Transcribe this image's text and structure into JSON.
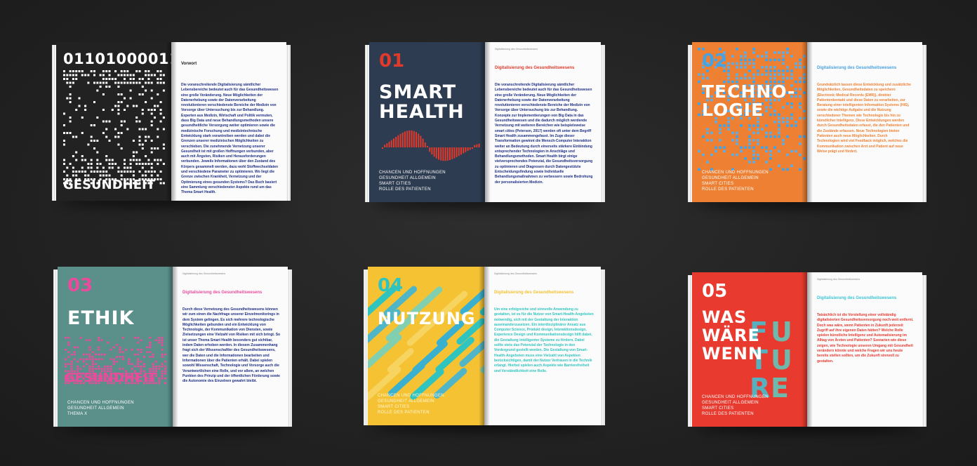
{
  "colors": {
    "background": "#262626",
    "book1_left": "#222222",
    "book1_accent": "#1f2f86",
    "book2_left": "#2d3c50",
    "book2_accent": "#e03a2c",
    "book3_left": "#ee8033",
    "book3_accent": "#4aa1e0",
    "book4_left": "#5b8f8a",
    "book4_accent": "#ea4b9c",
    "book5_left": "#f5c233",
    "book5_accent": "#2fc4bf",
    "book6_left": "#e83a2f",
    "book6_accent": "#3cc6d6"
  },
  "books": [
    {
      "id": "vorwort",
      "cover_lines": [
        "01101000011"
      ],
      "cover_title": "GESUNDHEIT",
      "right_title": "Vorwort",
      "right_body": "Die voranschreitende Digitalisierung sämtlicher Lebensbereiche bedeutet auch für das Gesundheitswesen eine große Veränderung. Neue Möglichkeiten der Datenerhebung sowie der Datenverarbeitung revolutionieren verschiedenste Bereiche der Medizin von Vorsorge über Untersuchung bis zur Behandlung. Experten aus Medizin, Wirtschaft und Politik vermuten, dass Big Data und neue Behandlungsmethoden unsere gesundheitliche Versorgung weiter optimieren sowie die medizinische Forschung und medizintechnische Entwicklung stark vorantreiben werden und dabei die Grenzen unserer medizinischen Möglichkeiten zu verschieben. Die zunehmende Vernetzung unserer Gesundheit ist mit großen Hoffnungen verbunden, aber auch mit Ängsten, Risiken und Herausforderungen verbunden. Jeweils Informationen über den Zustand des Körpers gesammelt werden, dazu wohl Stoffwechseldaten und verschiedene Parameter zu optimieren. Wo liegt die Grenze zwischen Krankheit, Vernetzung und der Optimierung eines gesunden Systems? Das Buch basiert eine Sammlung verschiedenster Aspekte rund um das Thema Smart Health."
    },
    {
      "id": "smart-health",
      "number": "01",
      "title": "SMART\nHEALTH",
      "chapters": "CHANCEN UND HOFFNUNGEN\nGESUNDHEIT ALLGEMEIN\nSMART CITIES\nROLLE DES PATIENTEN",
      "right_header": "Digitalisierung des Gesundheitswesens",
      "right_title": "Digitalisierung des Gesundheitswesens",
      "right_body": "Die voranschreitende Digitalisierung sämtlicher Lebensbereiche bedeutet auch für das Gesundheitswesen eine große Veränderung. Neue Möglichkeiten der Datenerhebung sowie der Datenverarbeitung revolutionieren verschiedenste Bereiche der Medizin von Vorsorge über Untersuchung bis zur Behandlung. Konzepte zur Implementierungen von Big Data in das Gesundheitswesen und die dadurch möglich werdende Vernetzung mit weiteren Bereichen wie beispielsweise smart cities (Petersen, 2017) werden oft unter dem Begriff Smart Health zusammengefasst. Im Zuge dieser Transformation gewinnt die Mensch-Computer Interaktion weiter an Bedeutung durch einerseits stärkere Einbindung entsprechender Technologien in Anschläge und Behandlungsmethoden. Smart Health birgt einige vielversprechendes Potenzial, die Gesundheitsversorgung zu optimieren und Diagnosen durch Datengestützte Entscheidungsfindung sowie Individuelle Behandlungsmaßnahmen zu verbessern sowie Bedrohung der personalisierten Medizin."
    },
    {
      "id": "technologie",
      "number": "02",
      "title": "TECHNO-\nLOGIE",
      "chapters": "CHANCEN UND HOFFNUNGEN\nGESUNDHEIT ALLGEMEIN\nSMART CITIES\nROLLE DES PATIENTEN",
      "right_title": "Digitalisierung des Gesundheitswesens",
      "right_body": "Grundsätzlich lassen diese Entwicklung und zusätzliche Möglichkeiten, Gesundheitsdaten zu speichern (Electronic Medical Records (EMR)), direkter Patientenkontakt und diese Daten zu verarbeiten, zur Beratung einer intelligenten Information Systems (HIS), sowie die wichtige Aufgabe und die Nutzung verschiedener Themen wie Technologie bis hin zu künstlicher Intelligenz. Diese Entwicklungen werden durch Gesundheitsdaten erfasst, die den Patienten und die Zustände erfassen. Neue Technologien bieten Patienten auch neue Möglichkeiten. Durch Technologien wird viel Feedback möglich, welches die Kommunikation zwischen Arzt und Patient auf neue Weise prägt und fördert."
    },
    {
      "id": "ethik",
      "number": "03",
      "title": "ETHIK",
      "cover_title": "GESUNDHEIT",
      "chapters": "CHANCEN UND HOFFNUNGEN\nGESUNDHEIT ALLGEMEIN\nTHEMA X",
      "right_header": "Digitalisierung des Gesundheitswesens",
      "right_title": "Digitalisierung des Gesundheitswesens",
      "right_body": "Durch diese Vernetzung des Gesundheitswesens können wir zum einen die Nachfrage unserer Einzelmonitorings in dem System gelingen. Es sich mehrere technologische Möglichkeiten gebunden und ein Entwicklung von Technologie, der Kommunikation von Diensten, sowie Zielsetzungen eine Vielzahl von Risiken mit sich bringt. So ist unser Thema Smart Health besonders gut sichtbar, indem Daten erhoben werden. In diesem Zusammenhang fragt sich der Wissenschaftler des Gesundheitswesens, wer die Daten und die Informationen bearbeiten und Informationen über die Patienten erhält. Dabei spielen sowohl Wissenschaft, Technologie und Vorsorge auch die Verantwortlichen eine Rolle, und vor allem, an welchen Punkten des Prinzip und der öffentlichen Förderung sowie die Autonomie des Einzelnen gewahrt bleibt."
    },
    {
      "id": "nutzung",
      "number": "04",
      "title": "NUTZUNG",
      "chapters": "CHANCEN UND HOFFNUNGEN\nGESUNDHEIT ALLGEMEIN\nSMART CITIES\nROLLE DES PATIENTEN",
      "right_header": "Digitalisierung des Gesundheitswesens",
      "right_title": "Digitalisierung des Gesundheitswesens",
      "right_body": "Um eine erfolgreiche und sinnvolle Anwendung zu gestalten, ist es für die Nutzer von Smart-Health-Angeboten notwendig, sich mit der Gestaltung der Interaktion auseinanderzusetzen. Ein interdisziplinärer Ansatz aus Computer Science, Produkt design, Interaktionsdesign, Experience Design und Kommunikationsdesign hilft dabei, die Gestaltung intelligenter Systeme zu fördern. Dabei sollte stets das Potenzial der Technologie in den Vordergrund gestellt werden. Die Gestaltung von Smart-Health-Angeboten muss eine Vielzahl von Aspekten berücksichtigen, damit der Nutzer Vertrauen in die Technik erlangt. Hierbei spielen auch Aspekte wie Barrierefreiheit und Verständlichkeit eine Rolle."
    },
    {
      "id": "was-waere-wenn",
      "number": "05",
      "title": "WAS\nWÄRE\nWENN",
      "overlay": "FUTURE",
      "chapters": "CHANCEN UND HOFFNUNGEN\nGESUNDHEIT ALLGEMEIN\nSMART CITIES\nROLLE DES PATIENTEN",
      "right_header": "Digitalisierung des Gesundheitswesens",
      "right_title": "Digitalisierung des Gesundheitswesens",
      "right_body": "Tatsächlich ist die Vorstellung einer vollständig digitalisierten Gesundheitsversorgung noch weit entfernt. Doch was wäre, wenn Patienten in Zukunft jederzeit Zugriff auf ihre eigenen Daten hätten? Welche Rolle spielen künstliche Intelligenz und Automatisierung im Alltag von Ärzten und Patienten? Szenarien wie diese zeigen, wie Technologie unseren Umgang mit Gesundheit verändern könnte und welche Fragen wir uns heute bereits stellen sollten, um die Zukunft sinnvoll zu gestalten."
    }
  ]
}
